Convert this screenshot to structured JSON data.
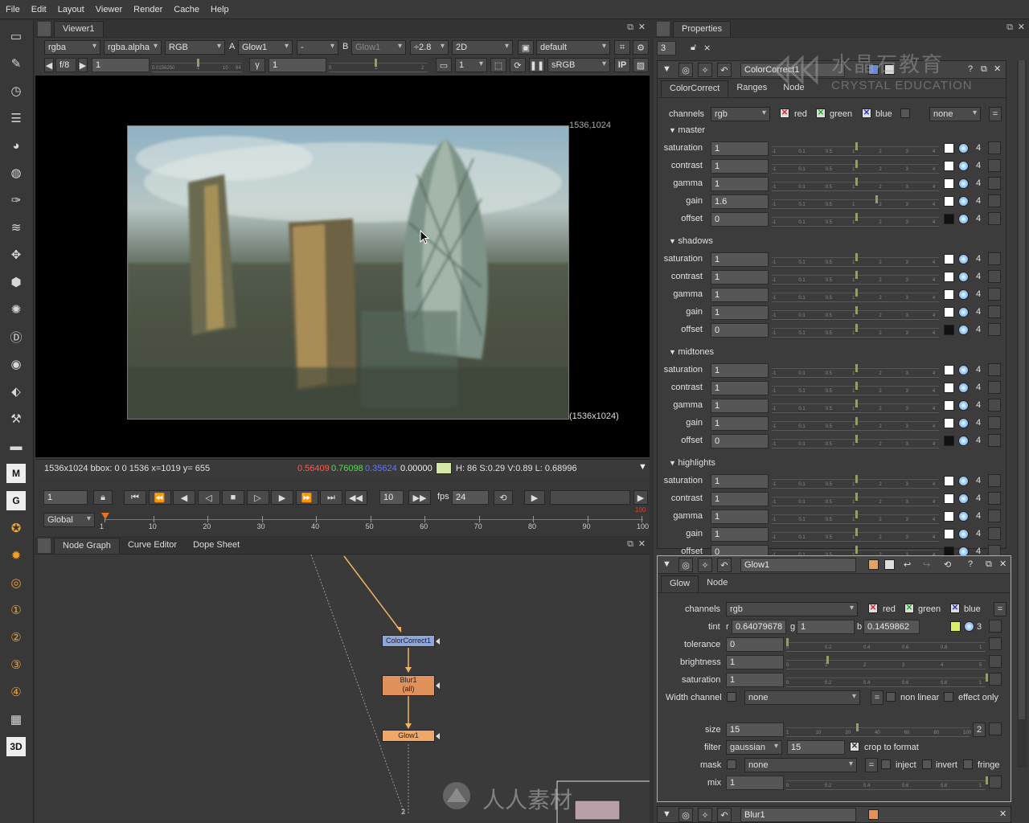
{
  "menu": [
    "File",
    "Edit",
    "Layout",
    "Viewer",
    "Render",
    "Cache",
    "Help"
  ],
  "viewer": {
    "tab": "Viewer1",
    "channels": "rgba",
    "alpha": "rgba.alpha",
    "display": "RGB",
    "a_label": "A",
    "a_input": "Glow1",
    "wipe": "-",
    "b_label": "B",
    "b_input": "Glow1",
    "zoom": "÷2.8",
    "mode": "2D",
    "lut": "default",
    "fstop": "f/8",
    "gain": "1",
    "gamma_label": "γ",
    "gamma": "1",
    "frame_field": "1",
    "colorspace": "sRGB",
    "ip": "IP",
    "gain_ticks": [
      "0.0156250",
      "1",
      "10",
      "64"
    ],
    "gamma_ticks": [
      "0",
      "1",
      "2"
    ],
    "format_top": "1536,1024",
    "format_bottom": "(1536x1024)",
    "status_info": "1536x1024  bbox: 0 0 1536  x=1019 y= 655",
    "pix_r": "0.56409",
    "pix_g": "0.76098",
    "pix_b": "0.35624",
    "pix_a": "0.00000",
    "pix_hsv": "H: 86 S:0.29 V:0.89  L: 0.68996",
    "pix_color": "#d4e8a8"
  },
  "timeline": {
    "frame": "1",
    "step": "10",
    "fps_label": "fps",
    "fps": "24",
    "scope": "Global",
    "ticks": [
      "1",
      "10",
      "20",
      "30",
      "40",
      "50",
      "60",
      "70",
      "80",
      "90",
      "100"
    ],
    "end_marker": "100"
  },
  "nodegraph": {
    "tabs": [
      "Node Graph",
      "Curve Editor",
      "Dope Sheet"
    ],
    "nodes": [
      {
        "name": "ColorCorrect1",
        "color": "#8fa6d8"
      },
      {
        "name": "Blur1",
        "sub": "(all)",
        "color": "#e0925a"
      },
      {
        "name": "Glow1",
        "color": "#f0a868"
      }
    ],
    "bottom_label": "2"
  },
  "properties": {
    "tab": "Properties",
    "max_panels": "3",
    "colorcorrect": {
      "name": "ColorCorrect1",
      "tabs": [
        "ColorCorrect",
        "Ranges",
        "Node"
      ],
      "channels_label": "channels",
      "channels": "rgb",
      "red": "red",
      "green": "green",
      "blue": "blue",
      "alpha_channel": "none",
      "sections": [
        {
          "title": "master",
          "rows": [
            {
              "label": "saturation",
              "value": "1",
              "thumb_pct": 0.5,
              "swatch": "#ffffff"
            },
            {
              "label": "contrast",
              "value": "1",
              "thumb_pct": 0.5,
              "swatch": "#ffffff"
            },
            {
              "label": "gamma",
              "value": "1",
              "thumb_pct": 0.5,
              "swatch": "#ffffff"
            },
            {
              "label": "gain",
              "value": "1.6",
              "thumb_pct": 0.62,
              "swatch": "#ffffff"
            },
            {
              "label": "offset",
              "value": "0",
              "thumb_pct": 0.5,
              "swatch": "#111111"
            }
          ]
        },
        {
          "title": "shadows",
          "rows": [
            {
              "label": "saturation",
              "value": "1",
              "thumb_pct": 0.5,
              "swatch": "#ffffff"
            },
            {
              "label": "contrast",
              "value": "1",
              "thumb_pct": 0.5,
              "swatch": "#ffffff"
            },
            {
              "label": "gamma",
              "value": "1",
              "thumb_pct": 0.5,
              "swatch": "#ffffff"
            },
            {
              "label": "gain",
              "value": "1",
              "thumb_pct": 0.5,
              "swatch": "#ffffff"
            },
            {
              "label": "offset",
              "value": "0",
              "thumb_pct": 0.5,
              "swatch": "#111111"
            }
          ]
        },
        {
          "title": "midtones",
          "rows": [
            {
              "label": "saturation",
              "value": "1",
              "thumb_pct": 0.5,
              "swatch": "#ffffff"
            },
            {
              "label": "contrast",
              "value": "1",
              "thumb_pct": 0.5,
              "swatch": "#ffffff"
            },
            {
              "label": "gamma",
              "value": "1",
              "thumb_pct": 0.5,
              "swatch": "#ffffff"
            },
            {
              "label": "gain",
              "value": "1",
              "thumb_pct": 0.5,
              "swatch": "#ffffff"
            },
            {
              "label": "offset",
              "value": "0",
              "thumb_pct": 0.5,
              "swatch": "#111111"
            }
          ]
        },
        {
          "title": "highlights",
          "rows": [
            {
              "label": "saturation",
              "value": "1",
              "thumb_pct": 0.5,
              "swatch": "#ffffff"
            },
            {
              "label": "contrast",
              "value": "1",
              "thumb_pct": 0.5,
              "swatch": "#ffffff"
            },
            {
              "label": "gamma",
              "value": "1",
              "thumb_pct": 0.5,
              "swatch": "#ffffff"
            },
            {
              "label": "gain",
              "value": "1",
              "thumb_pct": 0.5,
              "swatch": "#ffffff"
            },
            {
              "label": "offset",
              "value": "0",
              "thumb_pct": 0.5,
              "swatch": "#111111"
            }
          ]
        }
      ],
      "channel_count": "4"
    },
    "glow": {
      "name": "Glow1",
      "tabs": [
        "Glow",
        "Node"
      ],
      "channels_label": "channels",
      "channels": "rgb",
      "red": "red",
      "green": "green",
      "blue": "blue",
      "tint_label": "tint",
      "tint_r_label": "r",
      "tint_r": "0.64079678",
      "tint_g_label": "g",
      "tint_g": "1",
      "tint_b_label": "b",
      "tint_b": "0.1459862",
      "tint_swatch": "#d8f06a",
      "tint_count": "3",
      "tolerance_label": "tolerance",
      "tolerance": "0",
      "brightness_label": "brightness",
      "brightness": "1",
      "saturation_label": "saturation",
      "saturation": "1",
      "width_label": "Width channel",
      "width_channel": "none",
      "nonlinear": "non linear",
      "effect_only": "effect only",
      "size_label": "size",
      "size": "15",
      "size_count": "2",
      "filter_label": "filter",
      "filter": "gaussian",
      "filter_value": "15",
      "crop": "crop to format",
      "mask_label": "mask",
      "mask": "none",
      "inject": "inject",
      "invert": "invert",
      "fringe": "fringe",
      "mix_label": "mix",
      "mix": "1",
      "tol_ticks": [
        "0",
        "0.2",
        "0.4",
        "0.6",
        "0.8",
        "1"
      ],
      "bright_ticks": [
        "0",
        "1",
        "2",
        "3",
        "4",
        "5"
      ],
      "size_ticks": [
        "1",
        "10",
        "20",
        "40",
        "60",
        "80",
        "100"
      ]
    },
    "blur": {
      "name": "Blur1"
    }
  },
  "watermark": {
    "cn": "水晶石教育",
    "en": "CRYSTAL EDUCATION",
    "cn2": "人人素材"
  }
}
